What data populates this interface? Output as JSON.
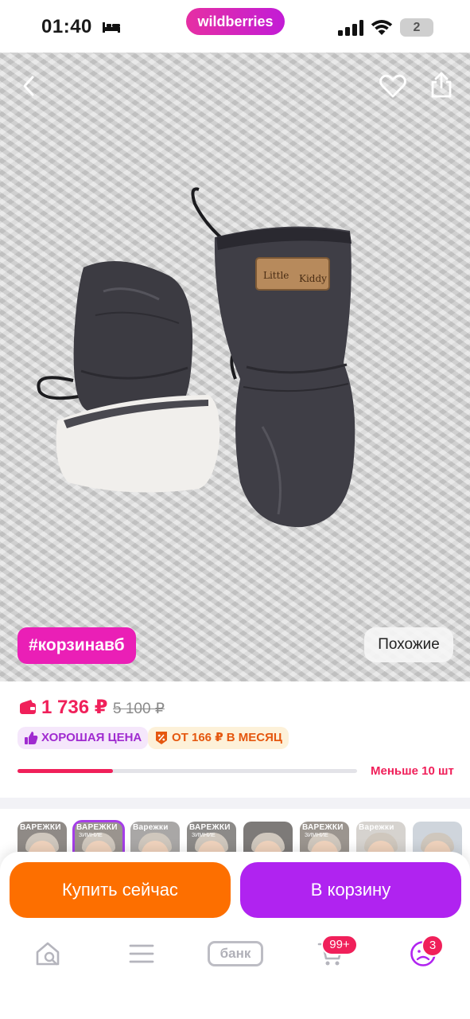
{
  "status_bar": {
    "time": "01:40",
    "brand": "wildberries",
    "battery": "2",
    "icons": [
      "bed-icon",
      "signal-icon",
      "wifi-icon",
      "battery-icon"
    ]
  },
  "product_image": {
    "description_icons": [
      "back-arrow-icon",
      "heart-icon",
      "share-icon"
    ],
    "label_text": [
      "Little",
      "Kiddy"
    ],
    "hashtag": "#корзинавб",
    "similar_label": "Похожие"
  },
  "price": {
    "current": "1 736 ₽",
    "old": "5 100 ₽",
    "badge_good": "ХОРОШАЯ ЦЕНА",
    "badge_installment": "ОТ 166 ₽ В МЕСЯЦ",
    "stock_text": "Меньше 10 шт",
    "stock_level_percent": 28
  },
  "thumbnails": [
    {
      "title": "ВАРЕЖКИ",
      "sub": "",
      "selected": false
    },
    {
      "title": "ВАРЕЖКИ",
      "sub": "ЗИМНИЕ",
      "selected": true
    },
    {
      "title": "Варежки",
      "sub": "",
      "selected": false
    },
    {
      "title": "ВАРЕЖКИ",
      "sub": "ЗИМНИЕ",
      "selected": false
    },
    {
      "title": "",
      "sub": "",
      "selected": false
    },
    {
      "title": "ВАРЕЖКИ",
      "sub": "ЗИМНИЕ",
      "selected": false
    },
    {
      "title": "Варежки",
      "sub": "",
      "selected": false
    },
    {
      "title": "",
      "sub": "",
      "selected": false
    }
  ],
  "actions": {
    "buy_now": "Купить сейчас",
    "add_to_cart": "В корзину"
  },
  "tab_bar": {
    "bank": "банк",
    "cart_count": "99+",
    "profile_count": "3"
  },
  "colors": {
    "brand_pink": "#ea1fb6",
    "price_red": "#f0205a",
    "buy_orange": "#fd6f00",
    "cart_purple": "#b023f0"
  }
}
